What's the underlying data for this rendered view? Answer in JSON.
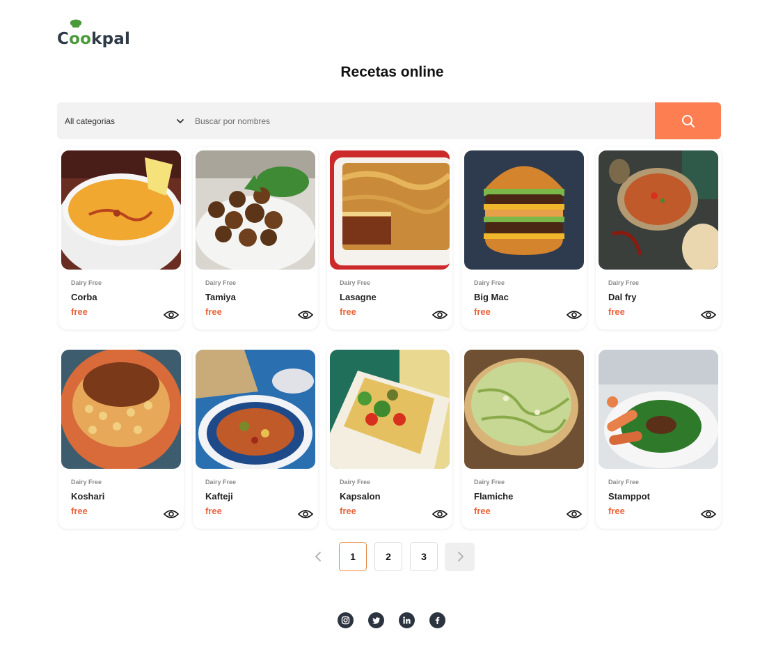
{
  "brand": {
    "logo_prefix": "C",
    "logo_oo": "oo",
    "logo_suffix": "kpal",
    "icon": "chef-hat-icon"
  },
  "page": {
    "title": "Recetas online"
  },
  "search": {
    "category_selected": "All categorias",
    "placeholder": "Buscar por nombres",
    "button_icon": "search-icon",
    "accent_color": "#fd7e50"
  },
  "recipes": [
    {
      "category": "Dairy Free",
      "name": "Corba",
      "price": "free"
    },
    {
      "category": "Dairy Free",
      "name": "Tamiya",
      "price": "free"
    },
    {
      "category": "Dairy Free",
      "name": "Lasagne",
      "price": "free"
    },
    {
      "category": "Dairy Free",
      "name": "Big Mac",
      "price": "free"
    },
    {
      "category": "Dairy Free",
      "name": "Dal fry",
      "price": "free"
    },
    {
      "category": "Dairy Free",
      "name": "Koshari",
      "price": "free"
    },
    {
      "category": "Dairy Free",
      "name": "Kafteji",
      "price": "free"
    },
    {
      "category": "Dairy Free",
      "name": "Kapsalon",
      "price": "free"
    },
    {
      "category": "Dairy Free",
      "name": "Flamiche",
      "price": "free"
    },
    {
      "category": "Dairy Free",
      "name": "Stamppot",
      "price": "free"
    }
  ],
  "pagination": {
    "pages": [
      "1",
      "2",
      "3"
    ],
    "current": "1"
  },
  "social": [
    "instagram-icon",
    "twitter-icon",
    "linkedin-icon",
    "facebook-icon"
  ],
  "colors": {
    "price": "#e8643c",
    "active_page_border": "#e8873c"
  }
}
